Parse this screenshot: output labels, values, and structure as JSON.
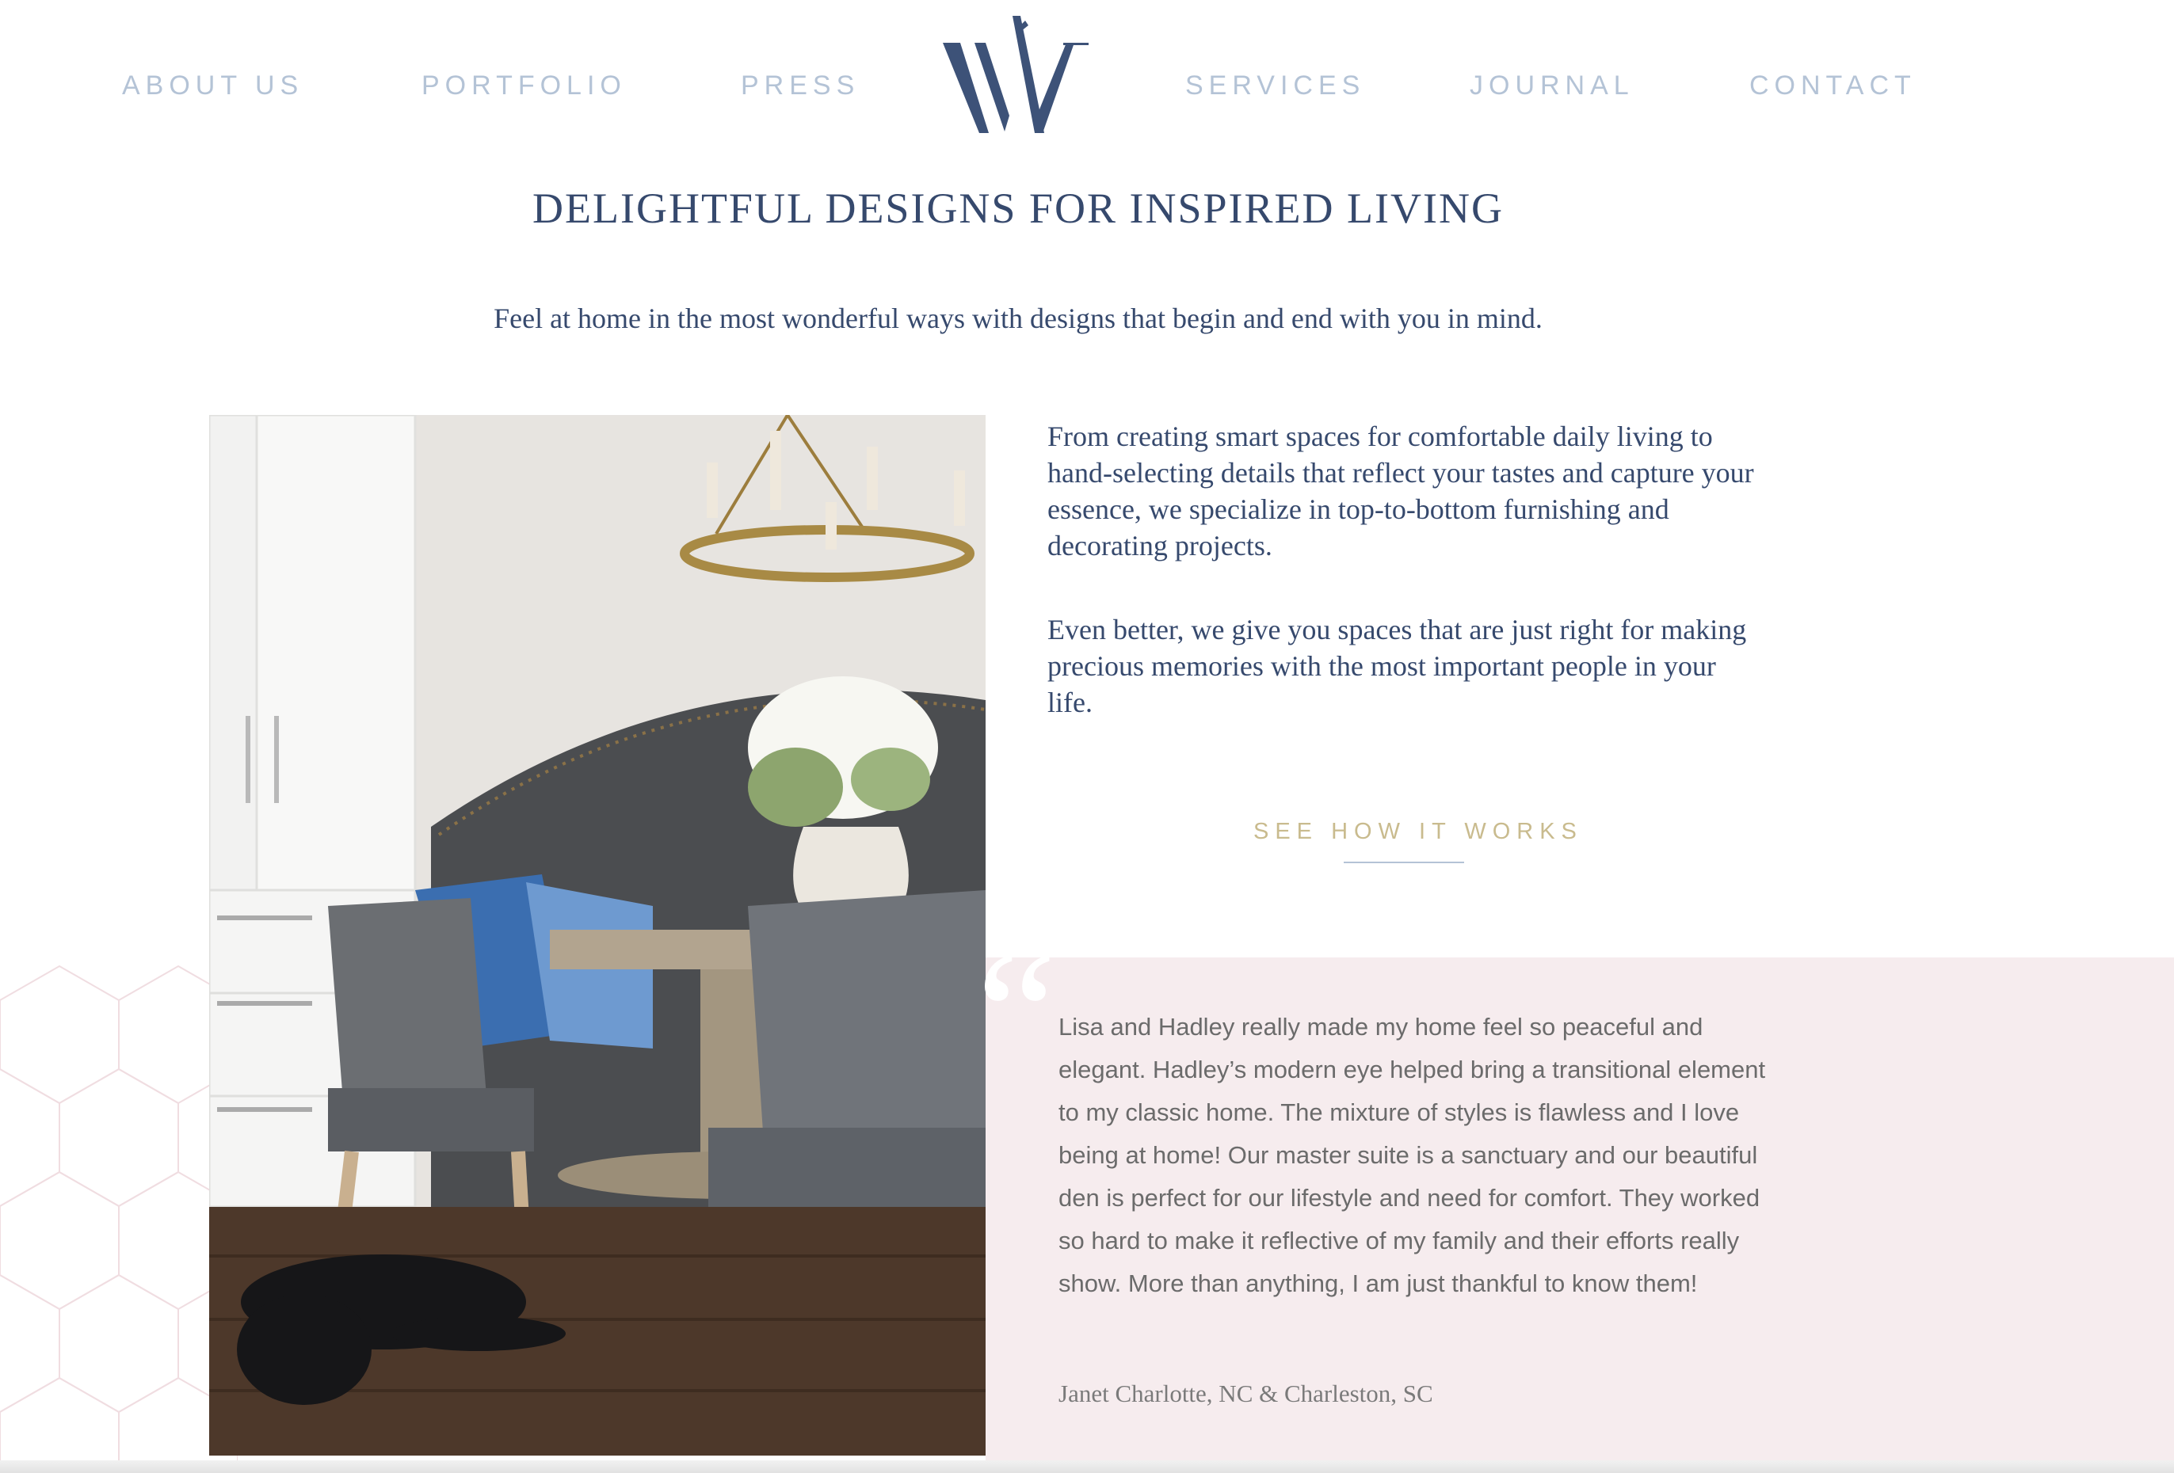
{
  "nav": {
    "left": [
      "ABOUT US",
      "PORTFOLIO",
      "PRESS"
    ],
    "right": [
      "SERVICES",
      "JOURNAL",
      "CONTACT"
    ],
    "logo_letter": "W"
  },
  "hero": {
    "headline": "DELIGHTFUL DESIGNS FOR INSPIRED LIVING",
    "subhead": "Feel at home in the most wonderful ways with designs that begin and end with you in mind."
  },
  "intro": {
    "paragraph_1": "From creating smart spaces for comfortable daily living to hand-selecting details that reflect your tastes and capture your essence, we specialize in top-to-bottom furnishing and decorating projects.",
    "paragraph_2": "Even better, we give you spaces that are just right for making precious memories with the most important people in your life.",
    "cta_label": "SEE HOW IT WORKS"
  },
  "testimonial": {
    "quote_mark": "“",
    "text": "Lisa and Hadley really made my home feel so peaceful and elegant. Hadley’s modern eye helped bring a transitional element to my classic home. The mixture of styles is flawless and I love being at home! Our master suite is a sanctuary and our beautiful den is perfect for our lifestyle and need for comfort. They worked so hard to make it reflective of my family and their efforts really show. More than anything, I am just thankful to know them!",
    "author": "Janet   Charlotte, NC & Charleston, SC"
  },
  "colors": {
    "navy": "#36496d",
    "nav_link": "#b4c3d6",
    "gold": "#c9bb8e",
    "pink_band": "#f6ecee"
  }
}
